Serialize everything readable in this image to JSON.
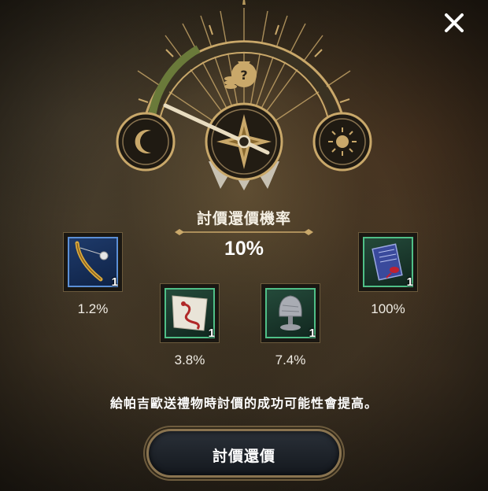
{
  "dialog": {
    "title": "討價還價機率",
    "success_rate": "10%",
    "description": "給帕吉歐送禮物時討價的成功可能性會提高。",
    "action_button_label": "討價還價",
    "close_icon": "close-icon"
  },
  "gauge": {
    "center_icon": "compass-icon",
    "left_icon": "moon-icon",
    "right_icon": "sun-icon",
    "top_icon": "money-bag-question-icon",
    "progress_fraction": 0.1,
    "colors": {
      "arc_fill": "#6a7a3a",
      "gold": "#c9a86a"
    }
  },
  "gifts": [
    {
      "name_icon": "golden-pipe-icon",
      "quantity": "1",
      "chance": "1.2%",
      "rarity": "blue"
    },
    {
      "name_icon": "dragon-kite-icon",
      "quantity": "1",
      "chance": "3.8%",
      "rarity": "green"
    },
    {
      "name_icon": "stone-idol-icon",
      "quantity": "1",
      "chance": "7.4%",
      "rarity": "green"
    },
    {
      "name_icon": "scroll-letter-icon",
      "quantity": "1",
      "chance": "100%",
      "rarity": "green"
    }
  ]
}
